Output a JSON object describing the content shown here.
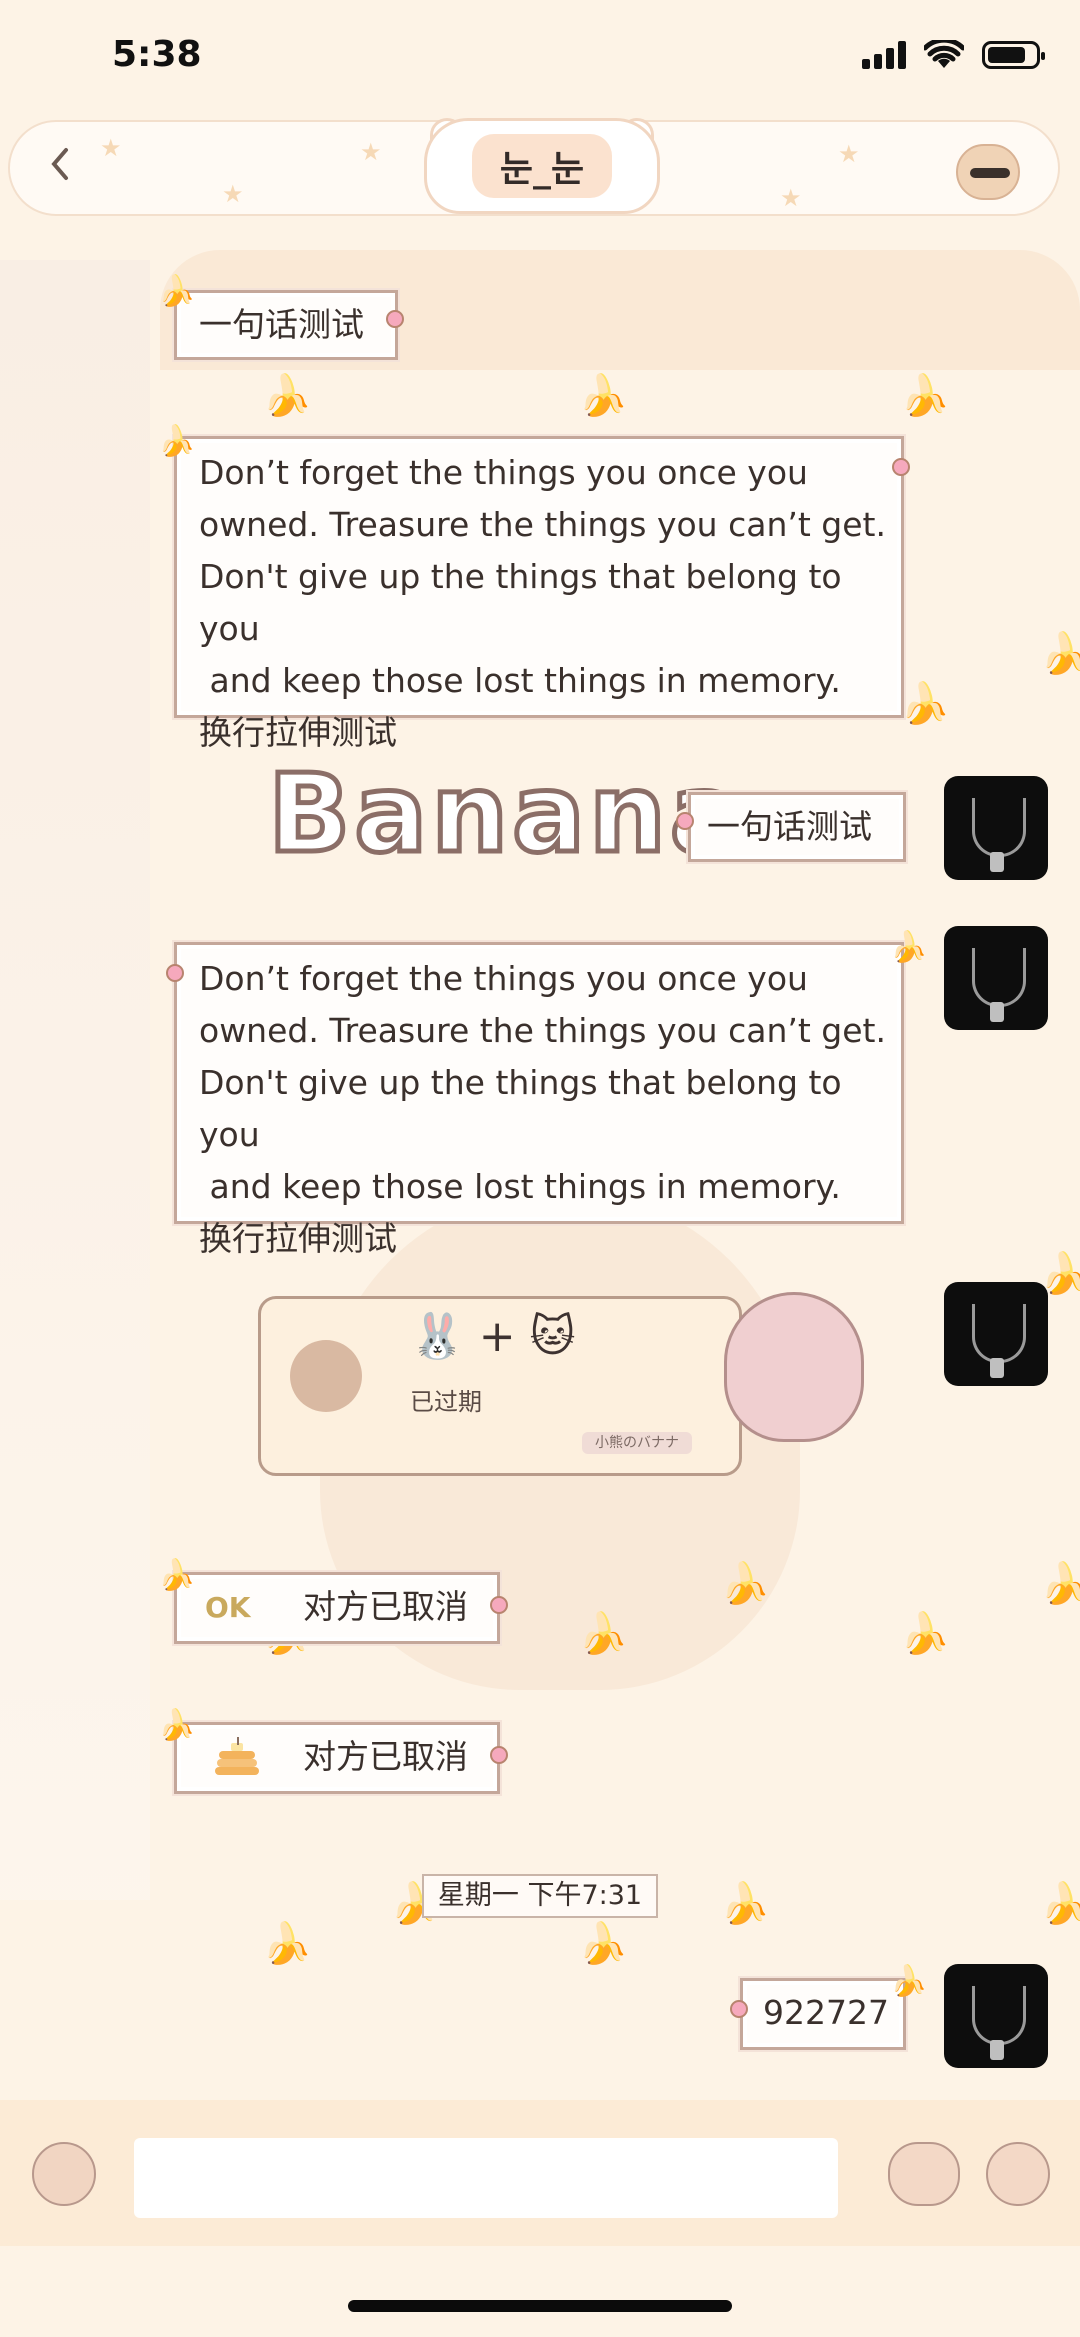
{
  "status_bar": {
    "time": "5:38"
  },
  "header": {
    "title": "눈_눈",
    "back_icon": "chevron-left-icon"
  },
  "messages": {
    "m1": {
      "text": "一句话测试"
    },
    "m2": {
      "text": "Don’t forget the things you once you\nowned. Treasure the things you can’t get.\nDon't give up the things that belong to you\n and keep those lost things in memory.\n换行拉伸测试"
    },
    "m3": {
      "text": "一句话测试"
    },
    "m4": {
      "text": "Don’t forget the things you once you\nowned. Treasure the things you can’t get.\nDon't give up the things that belong to you\n and keep those lost things in memory.\n换行拉伸测试"
    },
    "card": {
      "emojis": "🐰 + 🐱",
      "status": "已过期",
      "brand": "小熊のバナナ"
    },
    "m5": {
      "icon_text": "OK",
      "text": "对方已取消"
    },
    "m6": {
      "text": "对方已取消"
    },
    "timestamp": "星期一 下午7:31",
    "m7": {
      "text": "922727"
    }
  },
  "background": {
    "logo_text": "Banana"
  },
  "theme": {
    "bubble_border": "#c4a79a",
    "accent_pink": "#f6a9bd",
    "background": "#fdf3e6"
  }
}
